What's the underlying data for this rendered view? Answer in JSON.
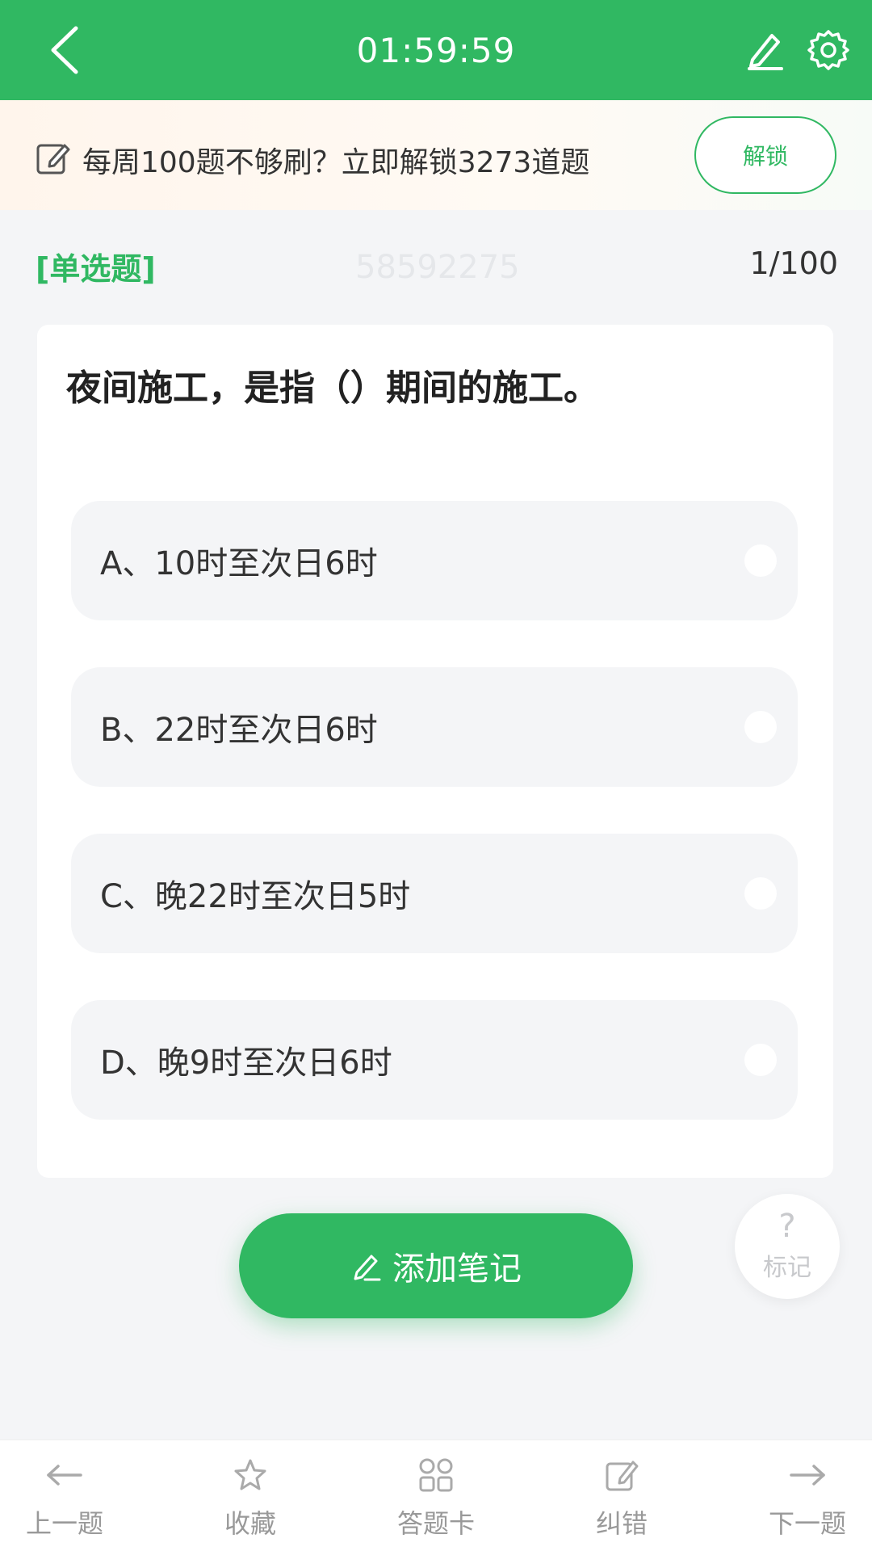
{
  "header": {
    "timer": "01:59:59"
  },
  "promo": {
    "text": "每周100题不够刷？立即解锁3273道题",
    "unlock_label": "解锁"
  },
  "meta": {
    "type_label": "[单选题]",
    "question_id": "58592275",
    "progress": "1/100"
  },
  "question": {
    "text": "夜间施工，是指（）期间的施工。",
    "options": [
      "A、10时至次日6时",
      "B、22时至次日6时",
      "C、晚22时至次日5时",
      "D、晚9时至次日6时"
    ]
  },
  "actions": {
    "add_note_label": "添加笔记",
    "mark_label": "标记"
  },
  "bottom_nav": {
    "items": [
      {
        "label": "上一题",
        "icon": "arrow-left-icon"
      },
      {
        "label": "收藏",
        "icon": "star-icon"
      },
      {
        "label": "答题卡",
        "icon": "grid-icon"
      },
      {
        "label": "纠错",
        "icon": "edit-icon"
      },
      {
        "label": "下一题",
        "icon": "arrow-right-icon"
      }
    ]
  },
  "colors": {
    "primary": "#30b862",
    "text": "#333333",
    "muted": "#999999"
  }
}
